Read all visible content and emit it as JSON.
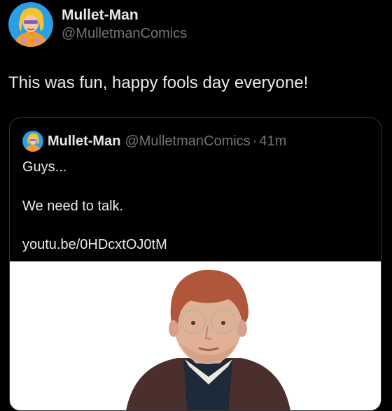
{
  "author": {
    "display_name": "Mullet-Man",
    "handle": "@MulletmanComics"
  },
  "tweet": {
    "text": "This was fun, happy fools day everyone!"
  },
  "quoted": {
    "display_name": "Mullet-Man",
    "handle": "@MulletmanComics",
    "separator": "·",
    "time": "41m",
    "lines": [
      "Guys...",
      "We need to talk.",
      "youtu.be/0HDcxtOJ0tM"
    ]
  },
  "colors": {
    "background": "#000000",
    "primary_text": "#e7e9ea",
    "secondary_text": "#71767b",
    "border": "#2f3336"
  }
}
